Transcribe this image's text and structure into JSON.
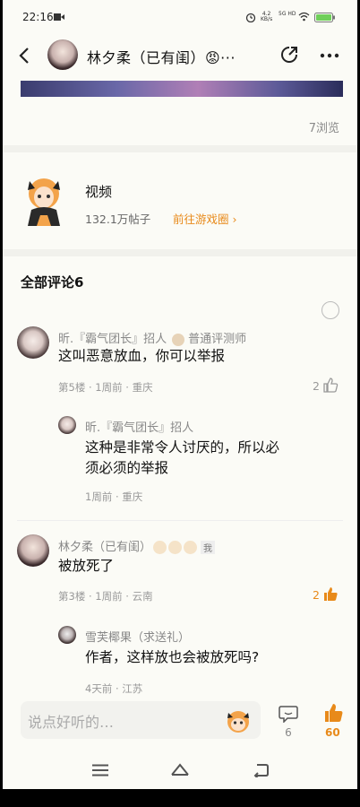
{
  "status_bar": {
    "time": "22:16",
    "net_speed": "4.2",
    "net_unit": "KB/s",
    "signal": "5G HD"
  },
  "header": {
    "title": "林夕柔（已有闺）😡···"
  },
  "post": {
    "views": "7浏览"
  },
  "forum": {
    "name": "视频",
    "stats": "132.1万帖子",
    "link": "前往游戏圈 ›"
  },
  "comments": {
    "title": "全部评论6",
    "items": [
      {
        "user": "昕.『霸气团长』招人",
        "badge": "普通评测师",
        "text": "这叫恶意放血，你可以举报",
        "meta": "第5楼 · 1周前 · 重庆",
        "likes": "2",
        "reply": {
          "user": "昕.『霸气团长』招人",
          "text_line1": "这种是非常令人讨厌的，所以必",
          "text_line2": "须必须的举报",
          "meta": "1周前 · 重庆"
        }
      },
      {
        "user": "林夕柔（已有闺）",
        "tag": "我",
        "text": "被放死了",
        "meta": "第3楼 · 1周前 · 云南",
        "likes": "2",
        "reply": {
          "user": "雪芙椰果（求送礼）",
          "text": "作者，这样放也会被放死吗?",
          "meta": "4天前 · 江苏"
        }
      }
    ]
  },
  "bottom_bar": {
    "placeholder": "说点好听的…",
    "comment_count": "6",
    "like_count": "60"
  },
  "colors": {
    "accent": "#e88a1a",
    "background": "#fbfbf6"
  }
}
